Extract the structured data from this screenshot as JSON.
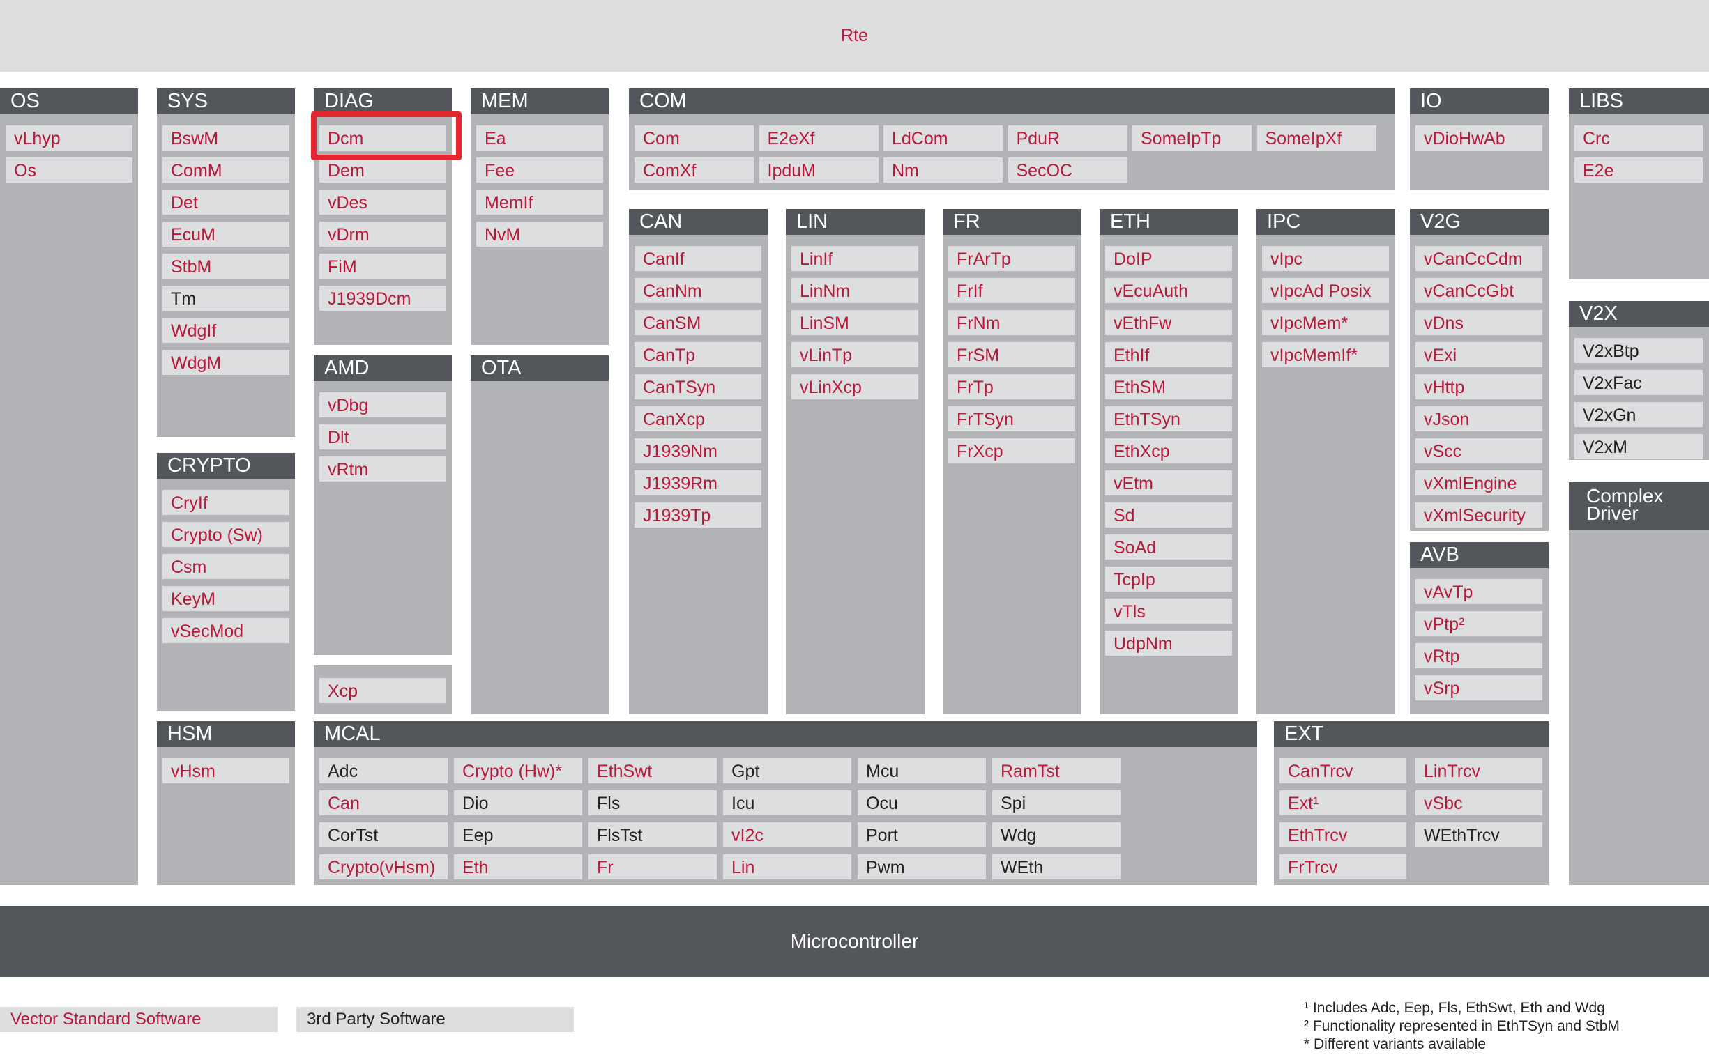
{
  "top_bar": "Rte",
  "bottom_bar": "Microcontroller",
  "highlight": {
    "group": "DIAG",
    "module": "Dcm",
    "color": "#e3262f"
  },
  "colors": {
    "vector": "#b8193a",
    "third_party": "#222222",
    "header_bg": "#53565a",
    "group_bg": "#b1b3b6",
    "module_bg": "#dcdee0"
  },
  "groups": [
    {
      "id": "os",
      "title": "OS",
      "modules": [
        {
          "label": "vLhyp",
          "vendor": "vector"
        },
        {
          "label": "Os",
          "vendor": "vector"
        }
      ]
    },
    {
      "id": "sys",
      "title": "SYS",
      "modules": [
        {
          "label": "BswM",
          "vendor": "vector"
        },
        {
          "label": "ComM",
          "vendor": "vector"
        },
        {
          "label": "Det",
          "vendor": "vector"
        },
        {
          "label": "EcuM",
          "vendor": "vector"
        },
        {
          "label": "StbM",
          "vendor": "vector"
        },
        {
          "label": "Tm",
          "vendor": "third"
        },
        {
          "label": "WdgIf",
          "vendor": "vector"
        },
        {
          "label": "WdgM",
          "vendor": "vector"
        }
      ]
    },
    {
      "id": "crypto",
      "title": "CRYPTO",
      "modules": [
        {
          "label": "CryIf",
          "vendor": "vector"
        },
        {
          "label": "Crypto (Sw)",
          "vendor": "vector"
        },
        {
          "label": "Csm",
          "vendor": "vector"
        },
        {
          "label": "KeyM",
          "vendor": "vector"
        },
        {
          "label": "vSecMod",
          "vendor": "vector"
        }
      ]
    },
    {
      "id": "hsm",
      "title": "HSM",
      "modules": [
        {
          "label": "vHsm",
          "vendor": "vector"
        }
      ]
    },
    {
      "id": "diag",
      "title": "DIAG",
      "modules": [
        {
          "label": "Dcm",
          "vendor": "vector"
        },
        {
          "label": "Dem",
          "vendor": "vector"
        },
        {
          "label": "vDes",
          "vendor": "vector"
        },
        {
          "label": "vDrm",
          "vendor": "vector"
        },
        {
          "label": "FiM",
          "vendor": "vector"
        },
        {
          "label": "J1939Dcm",
          "vendor": "vector"
        }
      ]
    },
    {
      "id": "amd",
      "title": "AMD",
      "modules": [
        {
          "label": "vDbg",
          "vendor": "vector"
        },
        {
          "label": "Dlt",
          "vendor": "vector"
        },
        {
          "label": "vRtm",
          "vendor": "vector"
        }
      ]
    },
    {
      "id": "xcp",
      "title": "",
      "modules": [
        {
          "label": "Xcp",
          "vendor": "vector"
        }
      ]
    },
    {
      "id": "mem",
      "title": "MEM",
      "modules": [
        {
          "label": "Ea",
          "vendor": "vector"
        },
        {
          "label": "Fee",
          "vendor": "vector"
        },
        {
          "label": "MemIf",
          "vendor": "vector"
        },
        {
          "label": "NvM",
          "vendor": "vector"
        }
      ]
    },
    {
      "id": "ota",
      "title": "OTA",
      "modules": []
    },
    {
      "id": "com",
      "title": "COM",
      "modules": [
        {
          "label": "Com",
          "vendor": "vector"
        },
        {
          "label": "E2eXf",
          "vendor": "vector"
        },
        {
          "label": "LdCom",
          "vendor": "vector"
        },
        {
          "label": "PduR",
          "vendor": "vector"
        },
        {
          "label": "SomeIpTp",
          "vendor": "vector"
        },
        {
          "label": "SomeIpXf",
          "vendor": "vector"
        },
        {
          "label": "ComXf",
          "vendor": "vector"
        },
        {
          "label": "IpduM",
          "vendor": "vector"
        },
        {
          "label": "Nm",
          "vendor": "vector"
        },
        {
          "label": "SecOC",
          "vendor": "vector"
        }
      ]
    },
    {
      "id": "can",
      "title": "CAN",
      "modules": [
        {
          "label": "CanIf",
          "vendor": "vector"
        },
        {
          "label": "CanNm",
          "vendor": "vector"
        },
        {
          "label": "CanSM",
          "vendor": "vector"
        },
        {
          "label": "CanTp",
          "vendor": "vector"
        },
        {
          "label": "CanTSyn",
          "vendor": "vector"
        },
        {
          "label": "CanXcp",
          "vendor": "vector"
        },
        {
          "label": "J1939Nm",
          "vendor": "vector"
        },
        {
          "label": "J1939Rm",
          "vendor": "vector"
        },
        {
          "label": "J1939Tp",
          "vendor": "vector"
        }
      ]
    },
    {
      "id": "lin",
      "title": "LIN",
      "modules": [
        {
          "label": "LinIf",
          "vendor": "vector"
        },
        {
          "label": "LinNm",
          "vendor": "vector"
        },
        {
          "label": "LinSM",
          "vendor": "vector"
        },
        {
          "label": "vLinTp",
          "vendor": "vector"
        },
        {
          "label": "vLinXcp",
          "vendor": "vector"
        }
      ]
    },
    {
      "id": "fr",
      "title": "FR",
      "modules": [
        {
          "label": "FrArTp",
          "vendor": "vector"
        },
        {
          "label": "FrIf",
          "vendor": "vector"
        },
        {
          "label": "FrNm",
          "vendor": "vector"
        },
        {
          "label": "FrSM",
          "vendor": "vector"
        },
        {
          "label": "FrTp",
          "vendor": "vector"
        },
        {
          "label": "FrTSyn",
          "vendor": "vector"
        },
        {
          "label": "FrXcp",
          "vendor": "vector"
        }
      ]
    },
    {
      "id": "eth",
      "title": "ETH",
      "modules": [
        {
          "label": "DoIP",
          "vendor": "vector"
        },
        {
          "label": "vEcuAuth",
          "vendor": "vector"
        },
        {
          "label": "vEthFw",
          "vendor": "vector"
        },
        {
          "label": "EthIf",
          "vendor": "vector"
        },
        {
          "label": "EthSM",
          "vendor": "vector"
        },
        {
          "label": "EthTSyn",
          "vendor": "vector"
        },
        {
          "label": "EthXcp",
          "vendor": "vector"
        },
        {
          "label": "vEtm",
          "vendor": "vector"
        },
        {
          "label": "Sd",
          "vendor": "vector"
        },
        {
          "label": "SoAd",
          "vendor": "vector"
        },
        {
          "label": "TcpIp",
          "vendor": "vector"
        },
        {
          "label": "vTls",
          "vendor": "vector"
        },
        {
          "label": "UdpNm",
          "vendor": "vector"
        }
      ]
    },
    {
      "id": "ipc",
      "title": "IPC",
      "modules": [
        {
          "label": "vIpc",
          "vendor": "vector"
        },
        {
          "label": "vIpcAd Posix",
          "vendor": "vector"
        },
        {
          "label": "vIpcMem*",
          "vendor": "vector"
        },
        {
          "label": "vIpcMemIf*",
          "vendor": "vector"
        }
      ]
    },
    {
      "id": "io",
      "title": "IO",
      "modules": [
        {
          "label": "vDioHwAb",
          "vendor": "vector"
        }
      ]
    },
    {
      "id": "v2g",
      "title": "V2G",
      "modules": [
        {
          "label": "vCanCcCdm",
          "vendor": "vector"
        },
        {
          "label": "vCanCcGbt",
          "vendor": "vector"
        },
        {
          "label": "vDns",
          "vendor": "vector"
        },
        {
          "label": "vExi",
          "vendor": "vector"
        },
        {
          "label": "vHttp",
          "vendor": "vector"
        },
        {
          "label": "vJson",
          "vendor": "vector"
        },
        {
          "label": "vScc",
          "vendor": "vector"
        },
        {
          "label": "vXmlEngine",
          "vendor": "vector"
        },
        {
          "label": "vXmlSecurity",
          "vendor": "vector"
        }
      ]
    },
    {
      "id": "avb",
      "title": "AVB",
      "modules": [
        {
          "label": "vAvTp",
          "vendor": "vector"
        },
        {
          "label": "vPtp²",
          "vendor": "vector"
        },
        {
          "label": "vRtp",
          "vendor": "vector"
        },
        {
          "label": "vSrp",
          "vendor": "vector"
        }
      ]
    },
    {
      "id": "libs",
      "title": "LIBS",
      "modules": [
        {
          "label": "Crc",
          "vendor": "vector"
        },
        {
          "label": "E2e",
          "vendor": "vector"
        }
      ]
    },
    {
      "id": "v2x",
      "title": "V2X",
      "modules": [
        {
          "label": "V2xBtp",
          "vendor": "third"
        },
        {
          "label": "V2xFac",
          "vendor": "third"
        },
        {
          "label": "V2xGn",
          "vendor": "third"
        },
        {
          "label": "V2xM",
          "vendor": "third"
        }
      ]
    },
    {
      "id": "cdd",
      "title": "Complex Driver",
      "modules": []
    },
    {
      "id": "mcal",
      "title": "MCAL",
      "modules": [
        {
          "label": "Adc",
          "vendor": "third"
        },
        {
          "label": "Crypto (Hw)*",
          "vendor": "vector"
        },
        {
          "label": "EthSwt",
          "vendor": "vector"
        },
        {
          "label": "Gpt",
          "vendor": "third"
        },
        {
          "label": "Mcu",
          "vendor": "third"
        },
        {
          "label": "RamTst",
          "vendor": "vector"
        },
        {
          "label": "Can",
          "vendor": "vector"
        },
        {
          "label": "Dio",
          "vendor": "third"
        },
        {
          "label": "Fls",
          "vendor": "third"
        },
        {
          "label": "Icu",
          "vendor": "third"
        },
        {
          "label": "Ocu",
          "vendor": "third"
        },
        {
          "label": "Spi",
          "vendor": "third"
        },
        {
          "label": "CorTst",
          "vendor": "third"
        },
        {
          "label": "Eep",
          "vendor": "third"
        },
        {
          "label": "FlsTst",
          "vendor": "third"
        },
        {
          "label": "vI2c",
          "vendor": "vector"
        },
        {
          "label": "Port",
          "vendor": "third"
        },
        {
          "label": "Wdg",
          "vendor": "third"
        },
        {
          "label": "Crypto(vHsm)",
          "vendor": "vector"
        },
        {
          "label": "Eth",
          "vendor": "vector"
        },
        {
          "label": "Fr",
          "vendor": "vector"
        },
        {
          "label": "Lin",
          "vendor": "vector"
        },
        {
          "label": "Pwm",
          "vendor": "third"
        },
        {
          "label": "WEth",
          "vendor": "third"
        }
      ]
    },
    {
      "id": "ext",
      "title": "EXT",
      "modules": [
        {
          "label": "CanTrcv",
          "vendor": "vector"
        },
        {
          "label": "LinTrcv",
          "vendor": "vector"
        },
        {
          "label": "Ext¹",
          "vendor": "vector"
        },
        {
          "label": "vSbc",
          "vendor": "vector"
        },
        {
          "label": "EthTrcv",
          "vendor": "vector"
        },
        {
          "label": "WEthTrcv",
          "vendor": "third"
        },
        {
          "label": "FrTrcv",
          "vendor": "vector"
        }
      ]
    }
  ],
  "legend": {
    "vector": "Vector Standard Software",
    "third_party": "3rd Party Software"
  },
  "footnotes": [
    "¹ Includes Adc, Eep, Fls, EthSwt, Eth and Wdg",
    "² Functionality represented in EthTSyn and StbM",
    "* Different variants available"
  ]
}
